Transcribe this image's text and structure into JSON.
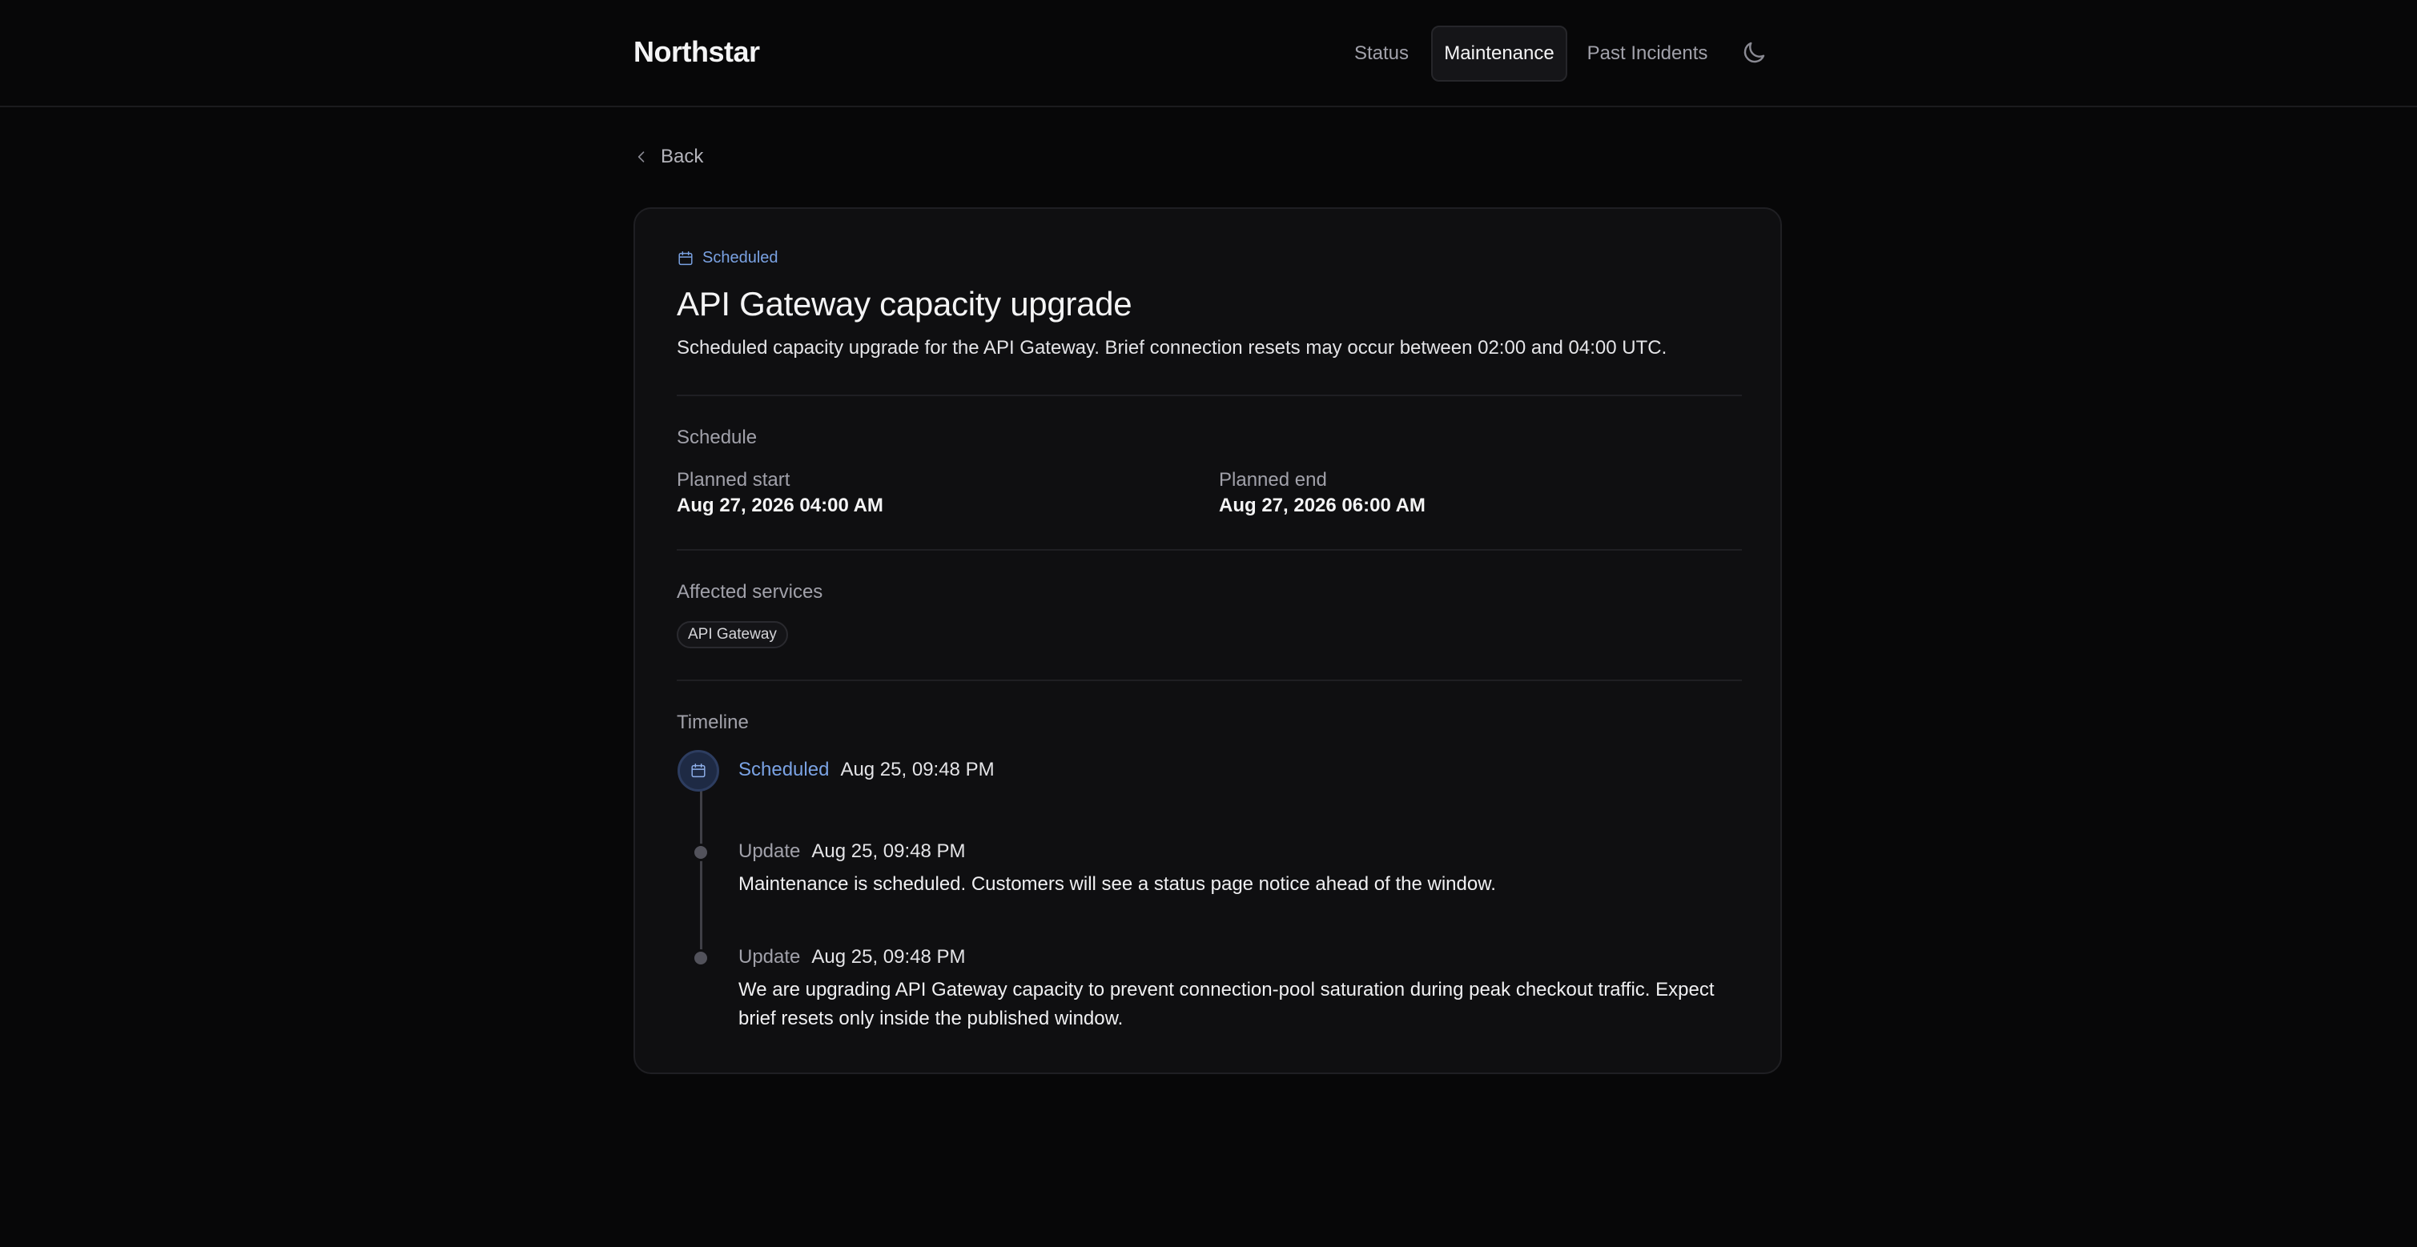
{
  "header": {
    "brand": "Northstar",
    "nav": [
      "Status",
      "Maintenance",
      "Past Incidents"
    ],
    "active_nav": "Maintenance",
    "theme_icon": "moon-icon"
  },
  "back_label": "Back",
  "maintenance": {
    "status": "Scheduled",
    "title": "API Gateway capacity upgrade",
    "description": "Scheduled capacity upgrade for the API Gateway. Brief connection resets may occur between 02:00 and 04:00 UTC.",
    "schedule": {
      "label": "Schedule",
      "start_label": "Planned start",
      "start_value": "Aug 27, 2026 04:00 AM",
      "end_label": "Planned end",
      "end_value": "Aug 27, 2026 06:00 AM"
    },
    "affected": {
      "label": "Affected services",
      "services": [
        "API Gateway"
      ]
    },
    "timeline": {
      "label": "Timeline",
      "entries": [
        {
          "kind": "Scheduled",
          "time": "Aug 25, 09:48 PM",
          "body": ""
        },
        {
          "kind": "Update",
          "time": "Aug 25, 09:48 PM",
          "body": "Maintenance is scheduled. Customers will see a status page notice ahead of the window."
        },
        {
          "kind": "Update",
          "time": "Aug 25, 09:48 PM",
          "body": "We are upgrading API Gateway capacity to prevent connection-pool saturation during peak checkout traffic. Expect brief resets only inside the published window."
        }
      ]
    }
  },
  "colors": {
    "background": "#070708",
    "card": "#0f0f11",
    "accent": "#7aa2e3"
  }
}
